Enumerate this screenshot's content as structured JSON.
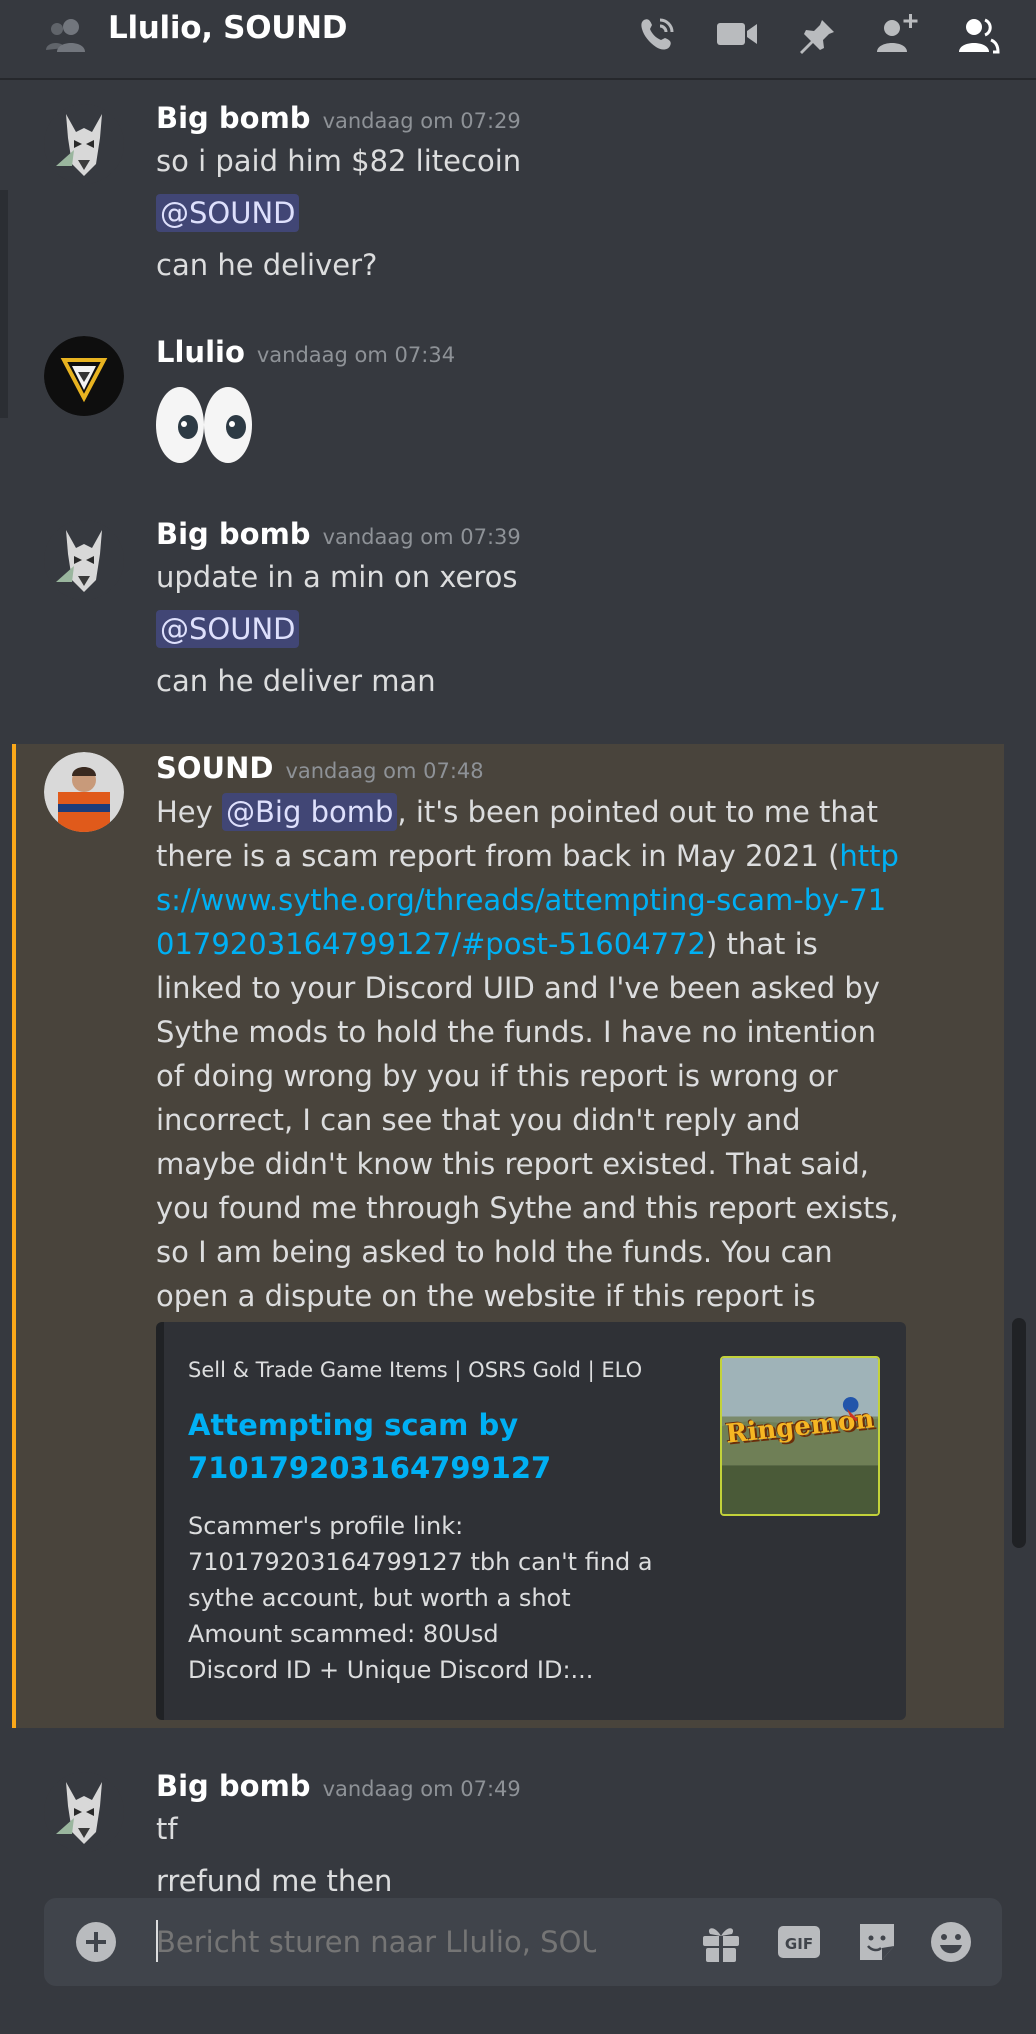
{
  "header": {
    "title": "Llulio, SOUND",
    "icons": [
      "people-icon",
      "call-icon",
      "video-icon",
      "pin-icon",
      "add-friend-icon",
      "member-list-icon"
    ]
  },
  "messages": [
    {
      "author": "Big bomb",
      "timestamp": "vandaag om 07:29",
      "lines": [
        "so i paid him $82 litecoin",
        "@SOUND",
        "can he deliver?"
      ]
    },
    {
      "author": "Llulio",
      "timestamp": "vandaag om 07:34",
      "emoji": "eyes"
    },
    {
      "author": "Big bomb",
      "timestamp": "vandaag om 07:39",
      "lines": [
        "update in a min on xeros",
        "@SOUND",
        "can he deliver man"
      ]
    },
    {
      "author": "SOUND",
      "timestamp": "vandaag om 07:48",
      "text_start": "Hey ",
      "mention": "@Big bomb",
      "text_mid": ", it's been pointed out to me that there is a scam report from back in May 2021 (",
      "link": "https://www.sythe.org/threads/attempting-scam-by-710179203164799127/#post-51604772",
      "text_end": ") that is linked to your Discord UID and I've been asked by Sythe mods to hold the funds. I have no intention of doing wrong by you if this report is wrong or incorrect, I can see that you didn't reply and maybe didn't know this report existed. That said, you found me through Sythe and this report exists, so I am being asked to hold the funds. You can open a dispute on the website if this report is incorrect/if you'd like to contest the case.",
      "embed": {
        "provider": "Sell & Trade Game Items | OSRS Gold | ELO",
        "title": "Attempting scam by 710179203164799127",
        "description_lines": [
          "Scammer's profile link:",
          "710179203164799127 tbh can't find a",
          "sythe account, but worth a shot",
          "Amount scammed: 80Usd",
          "Discord ID + Unique Discord ID:..."
        ],
        "thumbnail_text": "Ringemon"
      }
    },
    {
      "author": "Big bomb",
      "timestamp": "vandaag om 07:49",
      "lines": [
        "tf",
        "rrefund me then"
      ]
    }
  ],
  "composer": {
    "placeholder": "Bericht sturen naar Llulio, SOUND",
    "icons": [
      "gift-icon",
      "gif-icon",
      "sticker-icon",
      "emoji-icon"
    ]
  },
  "colors": {
    "background": "#36393f",
    "mention_bg": "#414675",
    "link": "#00b0f4",
    "highlight_bg": "#49443c",
    "highlight_bar": "#faa81a"
  }
}
